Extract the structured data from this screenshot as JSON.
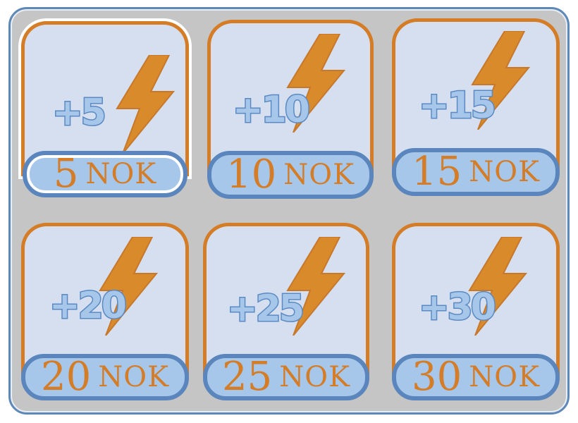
{
  "colors": {
    "panel_bg": "#c5c5c5",
    "panel_border": "#5e88b8",
    "card_bg": "#d5dff0",
    "card_border": "#d47c26",
    "bolt_fill": "#d98a2a",
    "amount_fill": "#a6c6ea",
    "amount_stroke": "#5b8ac2",
    "price_bg": "#a6c6ea",
    "price_border": "#5a86bd",
    "price_text": "#d47c26"
  },
  "shop": {
    "selected_index": 0,
    "icon": "lightning-bolt-icon",
    "items": [
      {
        "amount": "+5",
        "price": "5",
        "currency": "NOK"
      },
      {
        "amount": "+10",
        "price": "10",
        "currency": "NOK"
      },
      {
        "amount": "+15",
        "price": "15",
        "currency": "NOK"
      },
      {
        "amount": "+20",
        "price": "20",
        "currency": "NOK"
      },
      {
        "amount": "+25",
        "price": "25",
        "currency": "NOK"
      },
      {
        "amount": "+30",
        "price": "30",
        "currency": "NOK"
      }
    ]
  }
}
